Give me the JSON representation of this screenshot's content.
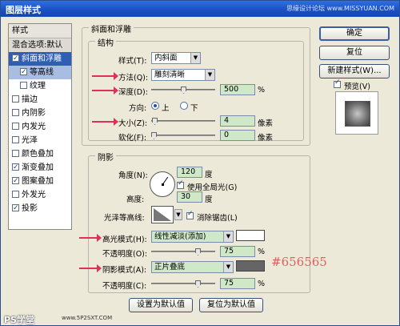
{
  "window": {
    "title": "图层样式",
    "watermark_top": "思缘设计论坛 www.MISSYUAN.COM"
  },
  "sidebar": {
    "header": "样式",
    "blend": "混合选项:默认",
    "items": [
      {
        "label": "斜面和浮雕",
        "checked": true
      },
      {
        "label": "等高线",
        "checked": true
      },
      {
        "label": "纹理",
        "checked": false
      },
      {
        "label": "描边",
        "checked": false
      },
      {
        "label": "内阴影",
        "checked": false
      },
      {
        "label": "内发光",
        "checked": false
      },
      {
        "label": "光泽",
        "checked": false
      },
      {
        "label": "颜色叠加",
        "checked": false
      },
      {
        "label": "渐变叠加",
        "checked": true
      },
      {
        "label": "图案叠加",
        "checked": true
      },
      {
        "label": "外发光",
        "checked": false
      },
      {
        "label": "投影",
        "checked": true
      }
    ]
  },
  "bevel": {
    "group_title": "斜面和浮雕",
    "structure_title": "结构",
    "style_label": "样式(T):",
    "style_value": "内斜面",
    "technique_label": "方法(Q):",
    "technique_value": "雕刻清晰",
    "depth_label": "深度(D):",
    "depth_value": "500",
    "depth_unit": "%",
    "depth_fraction": 0.5,
    "direction_label": "方向:",
    "direction_up": "上",
    "direction_down": "下",
    "size_label": "大小(Z):",
    "size_value": "4",
    "size_unit": "像素",
    "size_fraction": 0.02,
    "soften_label": "软化(F):",
    "soften_value": "0",
    "soften_unit": "像素",
    "soften_fraction": 0.0
  },
  "shading": {
    "group_title": "阴影",
    "angle_label": "角度(N):",
    "angle_value": "120",
    "angle_unit": "度",
    "global_light_label": "使用全局光(G)",
    "global_light_checked": true,
    "altitude_label": "高度:",
    "altitude_value": "30",
    "altitude_unit": "度",
    "gloss_label": "光泽等高线:",
    "antialias_label": "消除锯齿(L)",
    "antialias_checked": true,
    "highlight_mode_label": "高光模式(H):",
    "highlight_mode_value": "线性减淡(添加)",
    "highlight_color": "#ffffff",
    "highlight_opacity_label": "不透明度(O):",
    "highlight_opacity_value": "75",
    "highlight_opacity_unit": "%",
    "highlight_opacity_fraction": 0.75,
    "shadow_mode_label": "阴影模式(A):",
    "shadow_mode_value": "正片叠底",
    "shadow_color": "#656565",
    "shadow_color_note": "#656565",
    "shadow_opacity_label": "不透明度(C):",
    "shadow_opacity_value": "75",
    "shadow_opacity_unit": "%",
    "shadow_opacity_fraction": 0.75
  },
  "footer_buttons": {
    "set_default": "设置为默认值",
    "reset_default": "复位为默认值"
  },
  "right": {
    "ok": "确定",
    "reset": "复位",
    "new_style": "新建样式(W)...",
    "preview_label": "预览(V)",
    "preview_checked": true
  },
  "watermarks": {
    "ps": "PS学堂",
    "site": "www.5P2SXT.COM"
  },
  "colors": {
    "arrow": "#e0305a",
    "selected": "#2f5fb3",
    "field_green": "#cfe8c8"
  }
}
